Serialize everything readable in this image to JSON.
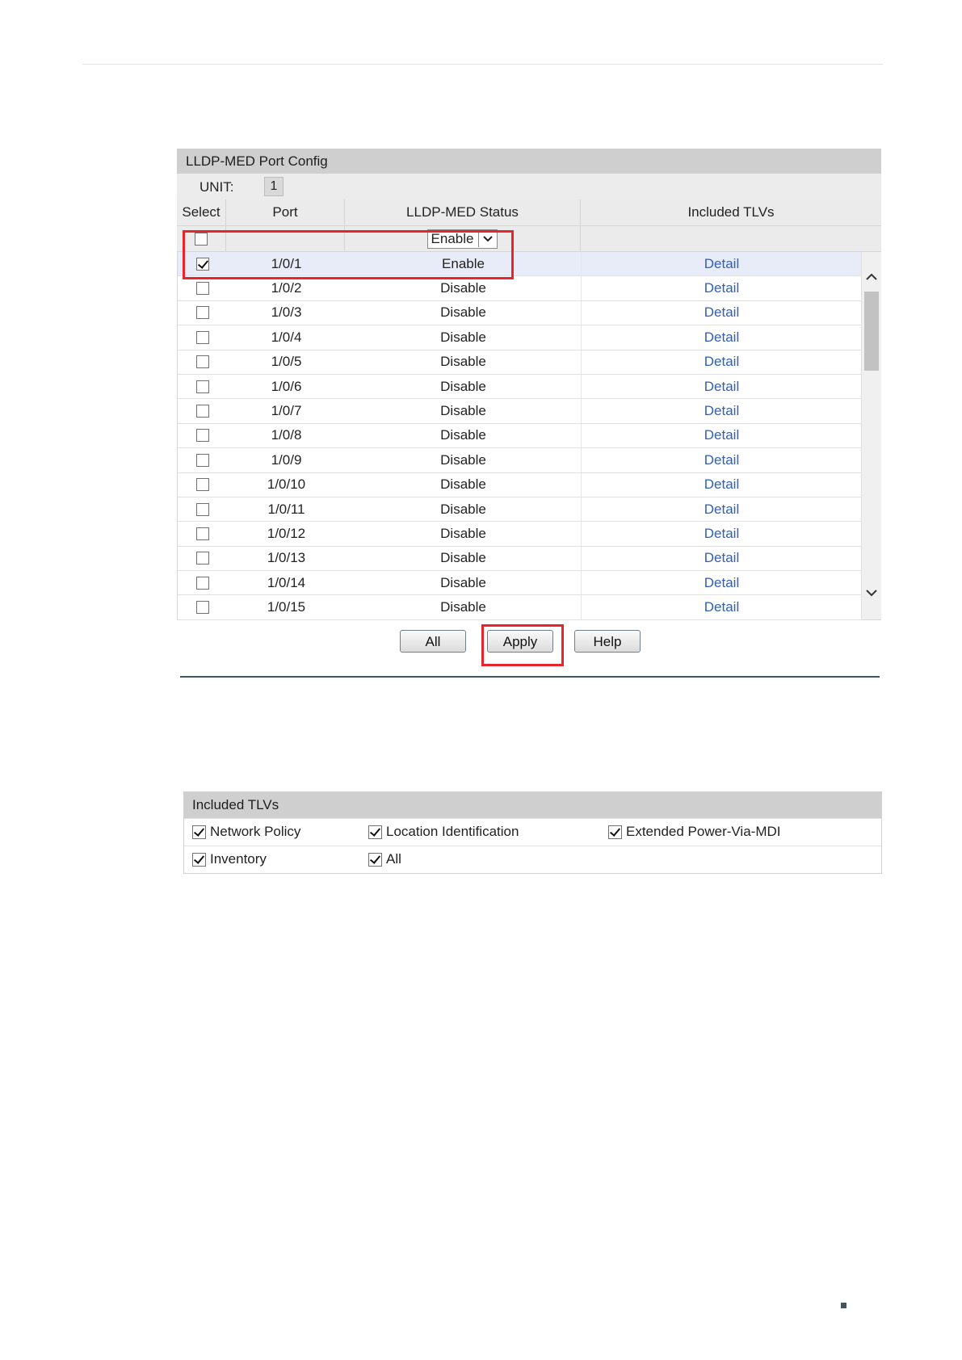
{
  "port_config": {
    "title": "LLDP-MED Port Config",
    "unit_label": "UNIT:",
    "unit_value": "1",
    "columns": {
      "select": "Select",
      "port": "Port",
      "status": "LLDP-MED Status",
      "tlvs": "Included TLVs"
    },
    "filter_status_value": "Enable",
    "rows": [
      {
        "port": "1/0/1",
        "status": "Enable",
        "link": "Detail",
        "checked": true
      },
      {
        "port": "1/0/2",
        "status": "Disable",
        "link": "Detail",
        "checked": false
      },
      {
        "port": "1/0/3",
        "status": "Disable",
        "link": "Detail",
        "checked": false
      },
      {
        "port": "1/0/4",
        "status": "Disable",
        "link": "Detail",
        "checked": false
      },
      {
        "port": "1/0/5",
        "status": "Disable",
        "link": "Detail",
        "checked": false
      },
      {
        "port": "1/0/6",
        "status": "Disable",
        "link": "Detail",
        "checked": false
      },
      {
        "port": "1/0/7",
        "status": "Disable",
        "link": "Detail",
        "checked": false
      },
      {
        "port": "1/0/8",
        "status": "Disable",
        "link": "Detail",
        "checked": false
      },
      {
        "port": "1/0/9",
        "status": "Disable",
        "link": "Detail",
        "checked": false
      },
      {
        "port": "1/0/10",
        "status": "Disable",
        "link": "Detail",
        "checked": false
      },
      {
        "port": "1/0/11",
        "status": "Disable",
        "link": "Detail",
        "checked": false
      },
      {
        "port": "1/0/12",
        "status": "Disable",
        "link": "Detail",
        "checked": false
      },
      {
        "port": "1/0/13",
        "status": "Disable",
        "link": "Detail",
        "checked": false
      },
      {
        "port": "1/0/14",
        "status": "Disable",
        "link": "Detail",
        "checked": false
      },
      {
        "port": "1/0/15",
        "status": "Disable",
        "link": "Detail",
        "checked": false
      }
    ],
    "buttons": {
      "all": "All",
      "apply": "Apply",
      "help": "Help"
    }
  },
  "included_tlvs": {
    "title": "Included TLVs",
    "options": {
      "network_policy": "Network Policy",
      "location_identification": "Location Identification",
      "extended_power": "Extended Power-Via-MDI",
      "inventory": "Inventory",
      "all": "All"
    }
  },
  "colors": {
    "highlight": "#e8242c",
    "link": "#2d5fbf",
    "header_gray": "#cfcfcf"
  }
}
